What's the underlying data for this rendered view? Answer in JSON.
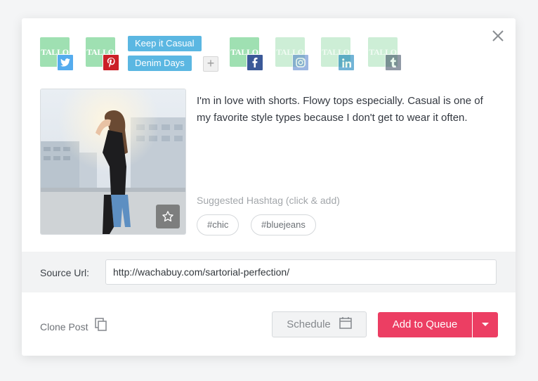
{
  "accounts": [
    {
      "logo_text": "TALLO",
      "network": "twitter-icon",
      "badge_color": "#55acee",
      "enabled": true
    },
    {
      "logo_text": "TALLO",
      "network": "pinterest-icon",
      "badge_color": "#cb2027",
      "enabled": true
    },
    {
      "logo_text": "TALLO",
      "network": "facebook-icon",
      "badge_color": "#3b5998",
      "enabled": true
    },
    {
      "logo_text": "TALLO",
      "network": "instagram-icon",
      "badge_color": "#4a7cc7",
      "enabled": false
    },
    {
      "logo_text": "TALLO",
      "network": "linkedin-icon",
      "badge_color": "#0077b5",
      "enabled": false
    },
    {
      "logo_text": "TALLO",
      "network": "tumblr-icon",
      "badge_color": "#36465d",
      "enabled": false
    }
  ],
  "boards": [
    "Keep it Casual",
    "Denim Days"
  ],
  "add_board_label": "+",
  "post": {
    "caption": "I'm in love with shorts. Flowy tops especially. Casual is one of my favorite style types because I don't get to wear it often.",
    "suggested_label": "Suggested Hashtag (click & add)",
    "hashtags": [
      "#chic",
      "#bluejeans"
    ]
  },
  "source": {
    "label": "Source Url:",
    "value": "http://wachabuy.com/sartorial-perfection/"
  },
  "footer": {
    "clone_label": "Clone Post",
    "schedule_label": "Schedule",
    "queue_label": "Add to Queue"
  },
  "colors": {
    "primary": "#ec3e63",
    "chip": "#5bb7e2",
    "logo_green": "#9fe0b2"
  }
}
